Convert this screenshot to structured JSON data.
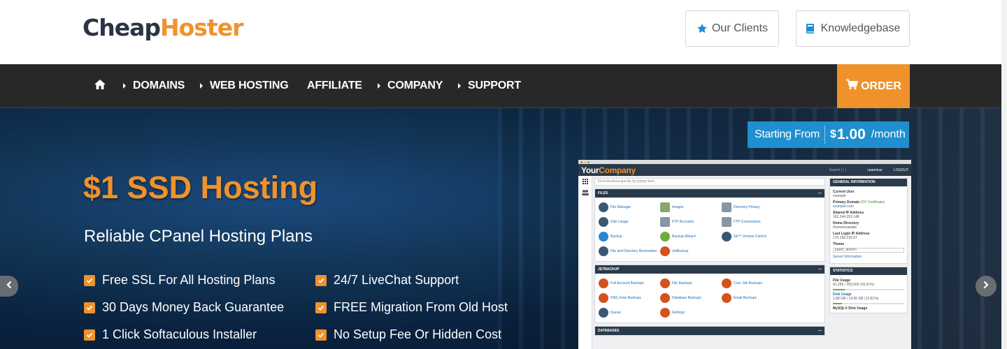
{
  "logo": {
    "part1": "Cheap",
    "part2": "Hoster"
  },
  "top_links": {
    "clients": "Our Clients",
    "knowledgebase": "Knowledgebase"
  },
  "nav": {
    "items": [
      "DOMAINS",
      "WEB HOSTING",
      "AFFILIATE",
      "COMPANY",
      "SUPPORT"
    ],
    "order": "ORDER"
  },
  "price": {
    "from": "Starting From",
    "currency": "$",
    "amount": "1.00",
    "period": "/month"
  },
  "hero": {
    "title": "$1 SSD Hosting",
    "subtitle": "Reliable CPanel Hosting Plans",
    "features": [
      "Free SSL For All Hosting Plans",
      "24/7 LiveChat Support",
      "30 Days Money Back Guarantee",
      "FREE Migration From Old Host",
      "1 Click Softaculous Installer",
      "No Setup Fee Or Hidden Cost"
    ]
  },
  "cpanel": {
    "logo": {
      "part1": "Your",
      "part2": "Company"
    },
    "search": "Search ( / )",
    "user": "cpanelusr",
    "logout": "LOGOUT",
    "find": "Find functions quickly by typing here.",
    "files": {
      "title": "FILES",
      "items": [
        "File Manager",
        "Images",
        "Directory Privacy",
        "Disk Usage",
        "FTP Accounts",
        "FTP Connections",
        "Backup",
        "Backup Wizard",
        "Git™ Version Control",
        "File and Directory Restoration",
        "JetBackup"
      ]
    },
    "jetbackup": {
      "title": "JETBACKUP",
      "items": [
        "Full Account Backups",
        "File Backups",
        "Cron Job Backups",
        "DNS Zone Backups",
        "Database Backups",
        "Email Backups",
        "Queue",
        "Settings"
      ]
    },
    "databases": {
      "title": "DATABASES"
    },
    "general": {
      "title": "GENERAL INFORMATION",
      "current_user_label": "Current User",
      "current_user": "example",
      "primary_domain_label": "Primary Domain",
      "primary_domain_note": "(DV Certificate)",
      "primary_domain": "example.com",
      "shared_ip_label": "Shared IP Address",
      "shared_ip": "162.244.253.148",
      "home_dir_label": "Home Directory",
      "home_dir": "/home/example",
      "last_login_label": "Last Login IP Address",
      "last_login": "175.158.225.57",
      "theme_label": "Theme",
      "theme": "paper_lantern",
      "server_info": "Server Information"
    },
    "stats": {
      "title": "STATISTICS",
      "file_usage_label": "File Usage",
      "file_usage": "41,265 / 250,000   (16.51%)",
      "file_usage_pct": 16.51,
      "disk_usage_label": "Disk Usage",
      "disk_usage": "1.88 GB / 14.65 GB   (12.81%)",
      "disk_usage_pct": 12.81,
      "mysql_label": "MySQL® Disk Usage"
    }
  },
  "colors": {
    "accent": "#f0922c",
    "nav_bg": "#282828",
    "price_bg": "#1f8fd0",
    "logo_dark": "#2c3345"
  }
}
